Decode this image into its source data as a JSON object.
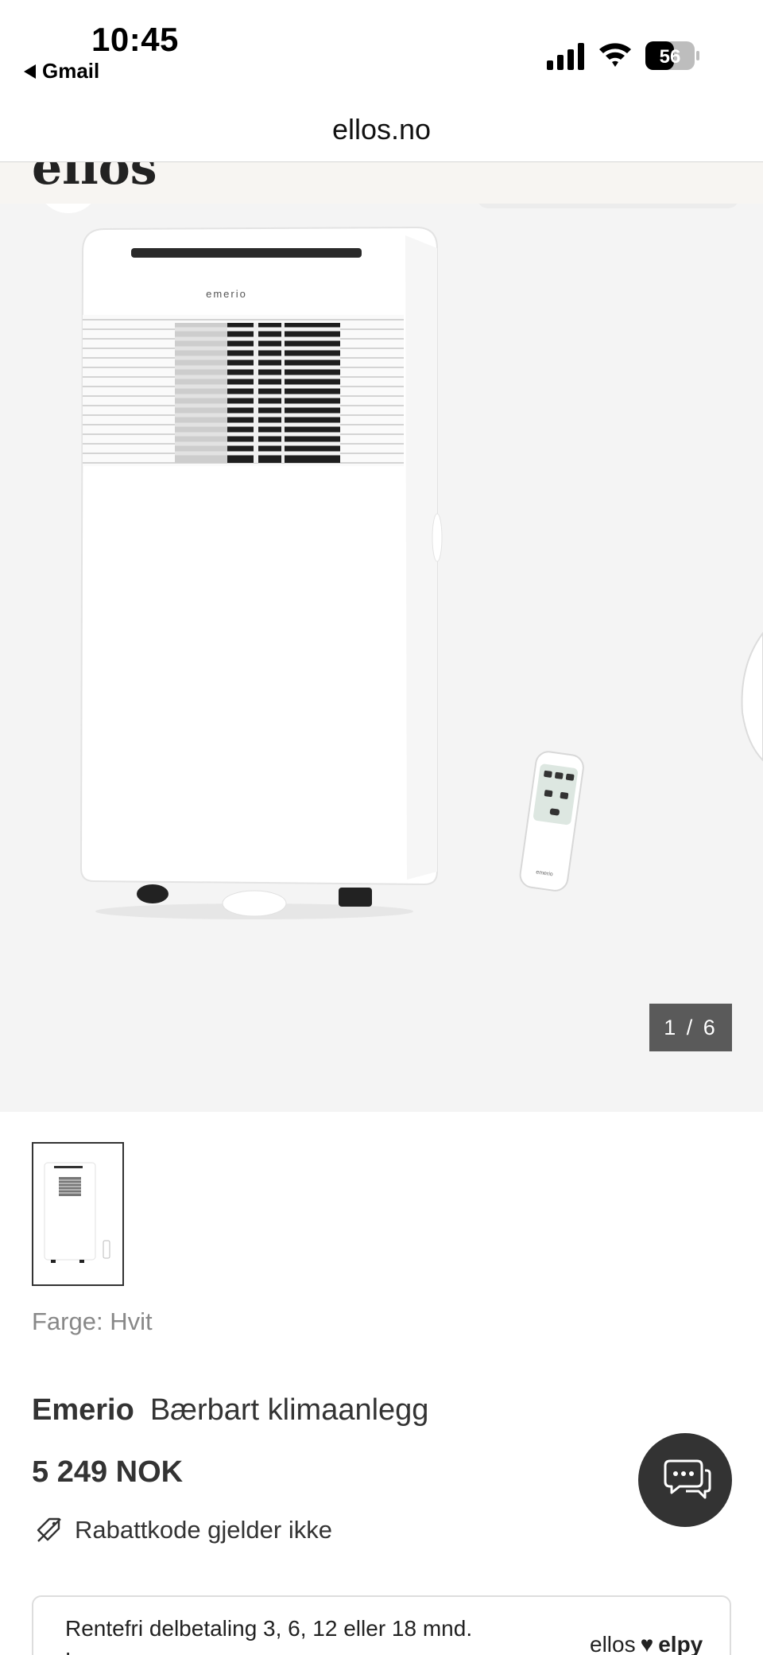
{
  "status_bar": {
    "time": "10:45",
    "back_app": "Gmail",
    "battery": "56"
  },
  "browser": {
    "url": "ellos.no"
  },
  "gallery": {
    "counter": "1 / 6",
    "remote_brand": "emerio",
    "unit_brand": "emerio"
  },
  "product": {
    "color_label": "Farge: Hvit",
    "brand": "Emerio",
    "name": "Bærbart klimaanlegg",
    "price": "5 249 NOK",
    "discount_note": "Rabattkode gjelder ikke"
  },
  "finance": {
    "text": "Rentefri delbetaling 3, 6, 12 eller 18 mnd.",
    "link": "Les mer",
    "logo_left": "ellos",
    "logo_right": "elpy"
  },
  "colors": {
    "chat_button": "#333333",
    "counter_bg": "#5a5a5a",
    "gallery_bg": "#f4f4f4"
  }
}
